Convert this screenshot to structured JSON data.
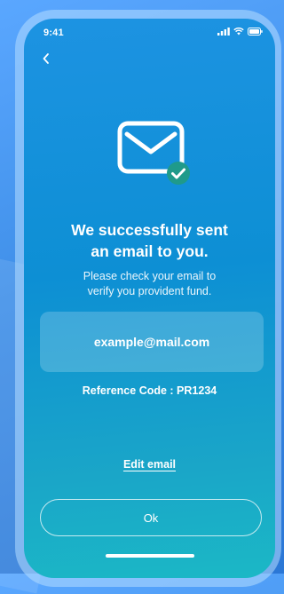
{
  "status_bar": {
    "time": "9:41"
  },
  "colors": {
    "accent": "#1d93e2",
    "check_badge": "#1f9a8a",
    "text": "#ffffff"
  },
  "icons": {
    "back": "chevron-left-icon",
    "mail": "envelope-icon",
    "check": "check-badge-icon",
    "signal": "signal-icon",
    "wifi": "wifi-icon",
    "battery": "battery-icon"
  },
  "confirmation": {
    "title": "We successfully sent\nan email to you.",
    "message": "Please check your email to\nverify you provident fund.",
    "email": "example@mail.com",
    "reference_code": "Reference Code : PR1234"
  },
  "actions": {
    "edit_email_label": "Edit email",
    "ok_label": "Ok"
  }
}
